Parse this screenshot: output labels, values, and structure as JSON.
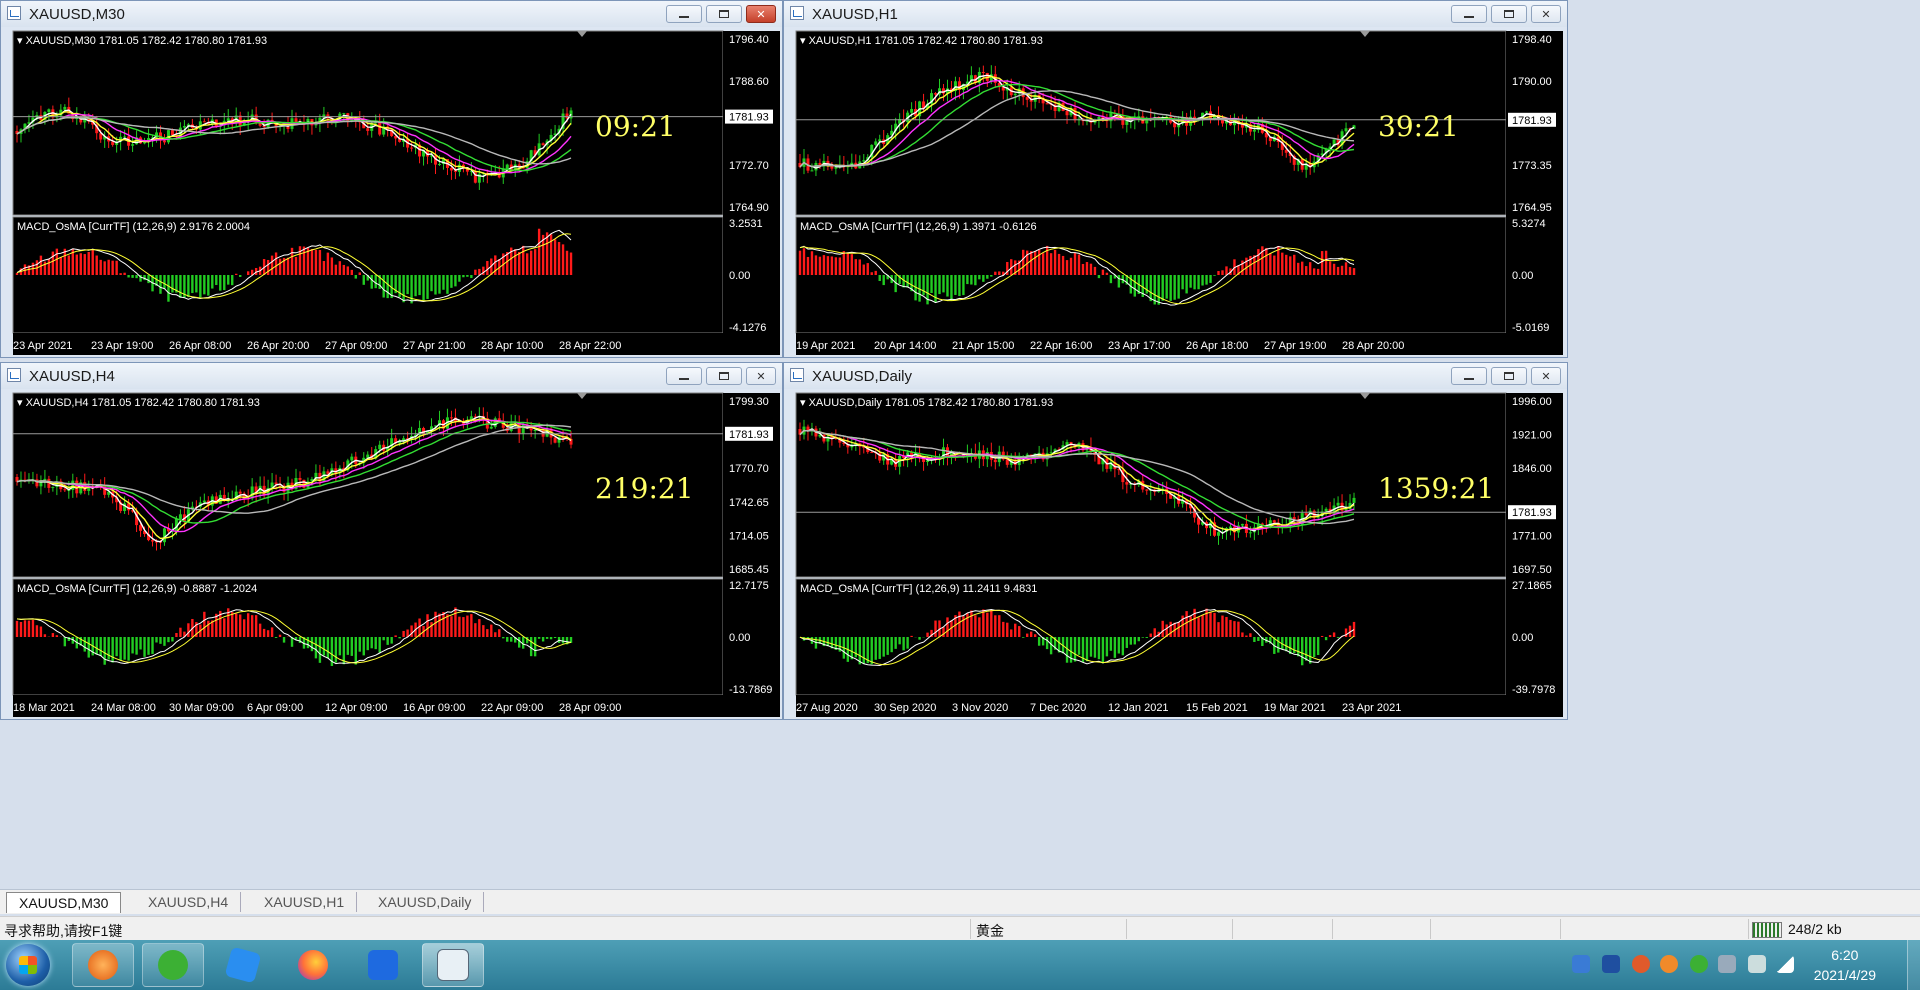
{
  "windows": [
    {
      "title": "XAUUSD,M30",
      "header": "XAUUSD,M30  1781.05 1782.42 1780.80 1781.93",
      "price_axis": [
        "1796.40",
        "1788.60",
        "1781.93",
        "1772.70",
        "1764.90"
      ],
      "current_price": "1781.93",
      "countdown": "09:21",
      "macd_label": "MACD_OsMA [CurrTF] (12,26,9) 2.9176 2.0004",
      "macd_axis": [
        "3.2531",
        "0.00",
        "-4.1276"
      ],
      "time_axis": [
        "23 Apr 2021",
        "23 Apr 19:00",
        "26 Apr 08:00",
        "26 Apr 20:00",
        "27 Apr 09:00",
        "27 Apr 21:00",
        "28 Apr 10:00",
        "28 Apr 22:00"
      ],
      "active": true
    },
    {
      "title": "XAUUSD,H1",
      "header": "XAUUSD,H1  1781.05 1782.42 1780.80 1781.93",
      "price_axis": [
        "1798.40",
        "1790.00",
        "1781.93",
        "1773.35",
        "1764.95"
      ],
      "current_price": "1781.93",
      "countdown": "39:21",
      "macd_label": "MACD_OsMA [CurrTF] (12,26,9) 1.3971 -0.6126",
      "macd_axis": [
        "5.3274",
        "0.00",
        "-5.0169"
      ],
      "time_axis": [
        "19 Apr 2021",
        "20 Apr 14:00",
        "21 Apr 15:00",
        "22 Apr 16:00",
        "23 Apr 17:00",
        "26 Apr 18:00",
        "27 Apr 19:00",
        "28 Apr 20:00"
      ],
      "active": false
    },
    {
      "title": "XAUUSD,H4",
      "header": "XAUUSD,H4  1781.05 1782.42 1780.80 1781.93",
      "price_axis": [
        "1799.30",
        "1781.93",
        "1770.70",
        "1742.65",
        "1714.05",
        "1685.45"
      ],
      "current_price": "1781.93",
      "countdown": "219:21",
      "macd_label": "MACD_OsMA [CurrTF] (12,26,9) -0.8887 -1.2024",
      "macd_axis": [
        "12.7175",
        "0.00",
        "-13.7869"
      ],
      "time_axis": [
        "18 Mar 2021",
        "24 Mar 08:00",
        "30 Mar 09:00",
        "6 Apr 09:00",
        "12 Apr 09:00",
        "16 Apr 09:00",
        "22 Apr 09:00",
        "28 Apr 09:00"
      ],
      "active": false
    },
    {
      "title": "XAUUSD,Daily",
      "header": "XAUUSD,Daily  1781.05 1782.42 1780.80 1781.93",
      "price_axis": [
        "1996.00",
        "1921.00",
        "1846.00",
        "1781.93",
        "1771.00",
        "1697.50"
      ],
      "current_price": "1781.93",
      "countdown": "1359:21",
      "macd_label": "MACD_OsMA [CurrTF] (12,26,9) 11.2411 9.4831",
      "macd_axis": [
        "27.1865",
        "0.00",
        "-39.7978"
      ],
      "time_axis": [
        "27 Aug 2020",
        "30 Sep 2020",
        "3 Nov 2020",
        "7 Dec 2020",
        "12 Jan 2021",
        "15 Feb 2021",
        "19 Mar 2021",
        "23 Apr 2021"
      ],
      "active": false
    }
  ],
  "tabs": [
    "XAUUSD,M30",
    "XAUUSD,H4",
    "XAUUSD,H1",
    "XAUUSD,Daily"
  ],
  "active_tab": "XAUUSD,M30",
  "status": {
    "help": "寻求帮助,请按F1键",
    "symbol": "黄金",
    "traffic": "248/2 kb"
  },
  "clock": {
    "time": "6:20",
    "date": "2021/4/29"
  },
  "colors": {
    "chart_bg": "#000000",
    "bull": "#ff1a1a",
    "bear": "#22cc22",
    "ma_white": "#ffffff",
    "ma_yellow": "#ffff33",
    "ma_magenta": "#ff33ff",
    "ma_green": "#33dd33",
    "ma_gray": "#b8b8b8",
    "countdown": "#ffff66"
  },
  "taskbar_icons": [
    "start-orb",
    "flame-app-icon",
    "wechat-icon",
    "pen-app-icon",
    "firefox-icon",
    "lark-icon",
    "mt4-terminal-icon"
  ]
}
